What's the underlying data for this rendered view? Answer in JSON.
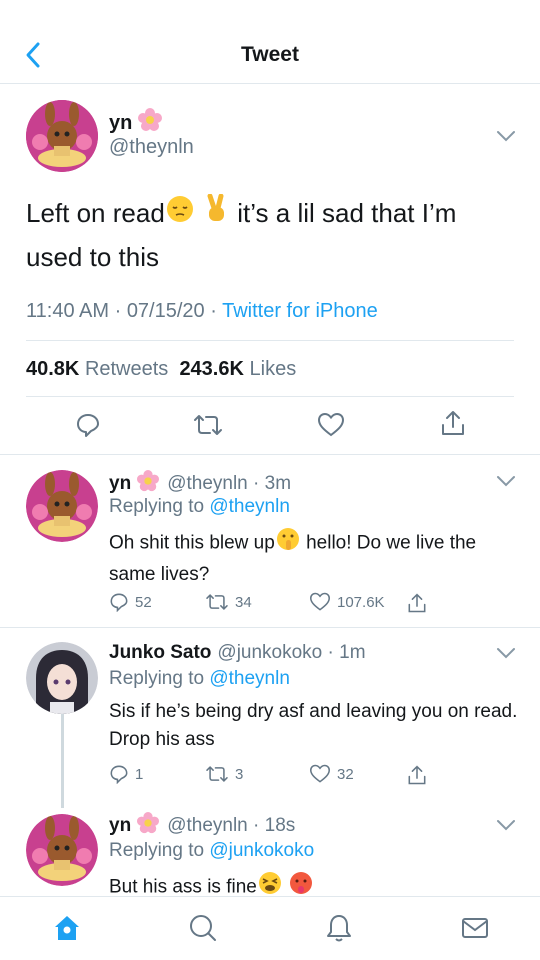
{
  "header": {
    "title": "Tweet"
  },
  "main_tweet": {
    "name": "yn",
    "handle": "@theynln",
    "text_part1": "Left on read",
    "text_part2": " it’s a lil sad that I’m used to this",
    "time": "11:40 AM",
    "date": "07/15/20",
    "client": "Twitter for iPhone",
    "retweets_count": "40.8K",
    "retweets_label": "Retweets",
    "likes_count": "243.6K",
    "likes_label": "Likes"
  },
  "replies": [
    {
      "name": "yn",
      "handle_time": "@theynln · 3m",
      "replying_label": "Replying to",
      "replying_to": "@theynln",
      "text_part1": "Oh shit this blew up",
      "text_part2": " hello! Do we live the same lives?",
      "replies": "52",
      "retweets": "34",
      "likes": "107.6K"
    },
    {
      "name": "Junko Sato",
      "handle_time": "@junkokoko · 1m",
      "replying_label": "Replying to",
      "replying_to": "@theynln",
      "text": "Sis if he’s being dry asf and leaving you on read. Drop his ass",
      "replies": "1",
      "retweets": "3",
      "likes": "32"
    },
    {
      "name": "yn",
      "handle_time": "@theynln · 18s",
      "replying_label": "Replying to",
      "replying_to": "@junkokoko",
      "text": "But his ass is fine"
    }
  ],
  "colors": {
    "accent": "#1da1f2",
    "secondary_text": "#657786",
    "divider": "#e1e8ed"
  }
}
